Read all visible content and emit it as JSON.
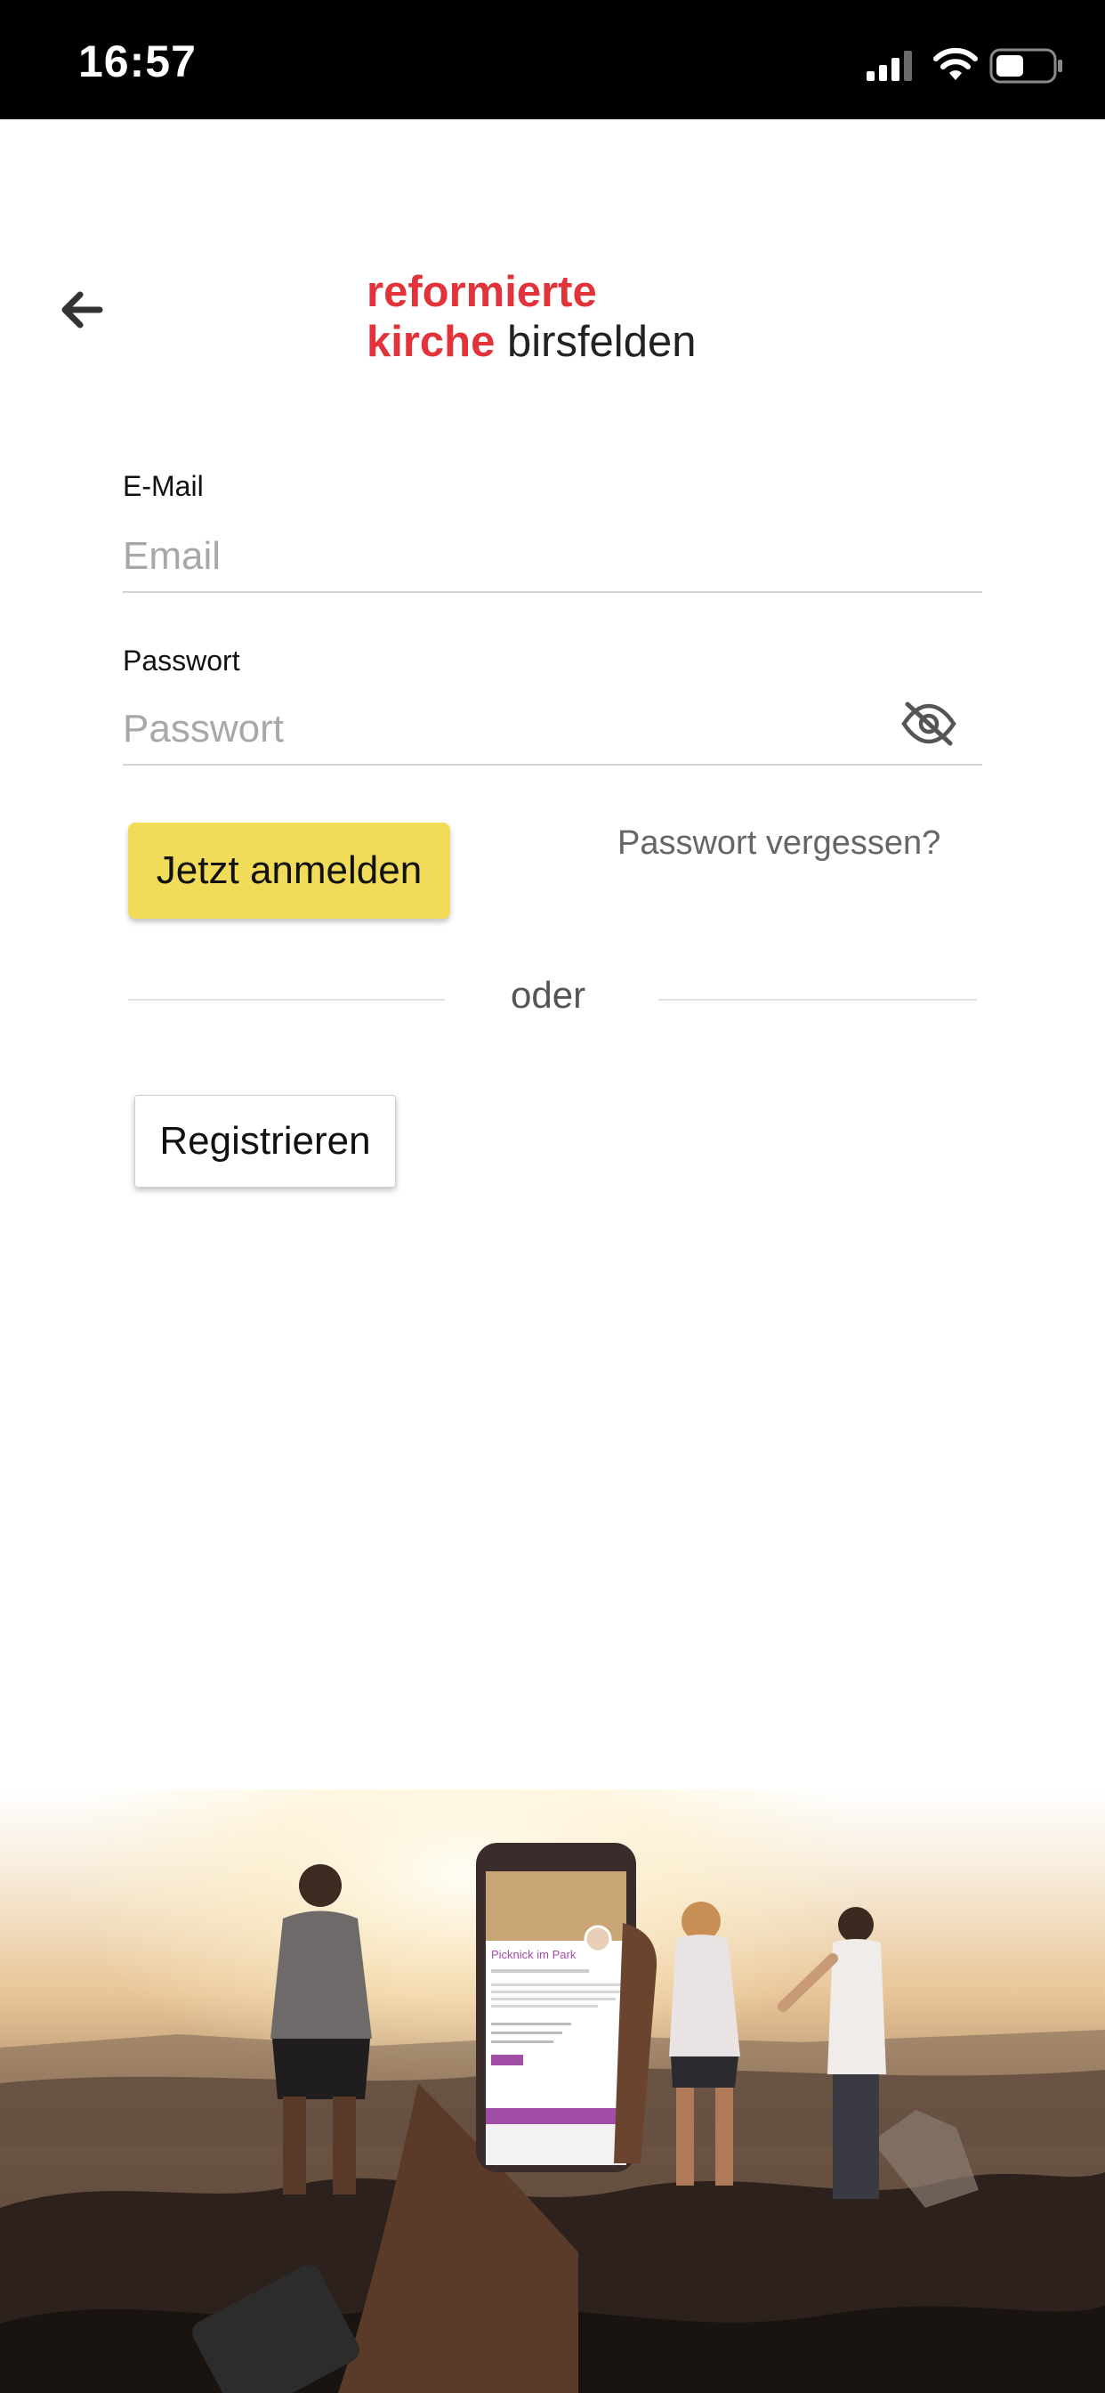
{
  "status_bar": {
    "time": "16:57"
  },
  "logo": {
    "line1": "reformierte",
    "line2_red": "kirche",
    "line2_dark": " birsfelden"
  },
  "form": {
    "email_label": "E-Mail",
    "email_placeholder": "Email",
    "password_label": "Passwort",
    "password_placeholder": "Passwort",
    "login_button": "Jetzt anmelden",
    "forgot_link": "Passwort vergessen?",
    "divider_text": "oder",
    "register_button": "Registrieren"
  },
  "hero_phone": {
    "event_title": "Picknick im Park"
  },
  "colors": {
    "brand_red": "#e2323a",
    "login_yellow": "#f1dc5a",
    "event_purple": "#a24da6"
  }
}
